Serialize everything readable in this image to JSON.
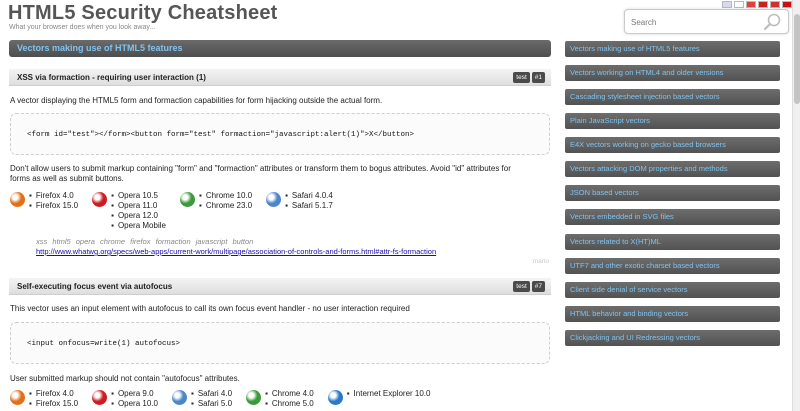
{
  "header": {
    "title": "HTML5 Security Cheatsheet",
    "tagline": "What your browser does when you look away...",
    "search_placeholder": "Search",
    "flags": [
      "#d8d8f0",
      "#ffffff",
      "#e04040",
      "#cc2020",
      "#d03030",
      "#cc1010"
    ]
  },
  "main": {
    "section_title": "Vectors making use of HTML5 features",
    "vectors": [
      {
        "title": "XSS via formaction - requiring user interaction (1)",
        "btn_test": "test",
        "btn_num": "#1",
        "description": "A vector displaying the HTML5 form and formaction capabilities for form hijacking outside the actual form.",
        "code": "<form id=\"test\"></form><button form=\"test\" formaction=\"javascript:alert(1)\">X</button>",
        "advice": "Don't allow users to submit markup containing \"form\" and \"formaction\" attributes or transform them to bogus attributes. Avoid \"id\" attributes for forms as well as submit buttons.",
        "browsers": [
          {
            "icon": "firefox-icon",
            "color": "#e0701c",
            "versions": [
              "Firefox 4.0",
              "Firefox 15.0"
            ]
          },
          {
            "icon": "opera-icon",
            "color": "#cc1b22",
            "versions": [
              "Opera 10.5",
              "Opera 11.0",
              "Opera 12.0",
              "Opera Mobile"
            ]
          },
          {
            "icon": "chrome-icon",
            "color": "#3c9a3c",
            "versions": [
              "Chrome 10.0",
              "Chrome 23.0"
            ]
          },
          {
            "icon": "safari-icon",
            "color": "#4a86c8",
            "versions": [
              "Safari 4.0.4",
              "Safari 5.1.7"
            ]
          }
        ],
        "tags": "xss html5 opera chrome firefox formaction javascript button",
        "link": "http://www.whatwg.org/specs/web-apps/current-work/multipage/association-of-controls-and-forms.html#attr-fs-formaction",
        "fade": "mario"
      },
      {
        "title": "Self-executing focus event via autofocus",
        "btn_test": "test",
        "btn_num": "#7",
        "description": "This vector uses an input element with autofocus to call its own focus event handler - no user interaction required",
        "code": "<input onfocus=write(1) autofocus>",
        "advice": "User submitted markup should not contain \"autofocus\" attributes.",
        "browsers": [
          {
            "icon": "firefox-icon",
            "color": "#e0701c",
            "versions": [
              "Firefox 4.0",
              "Firefox 15.0"
            ]
          },
          {
            "icon": "opera-icon",
            "color": "#cc1b22",
            "versions": [
              "Opera 9.0",
              "Opera 10.0"
            ]
          },
          {
            "icon": "safari-icon",
            "color": "#4a86c8",
            "versions": [
              "Safari 4.0",
              "Safari 5.0"
            ]
          },
          {
            "icon": "chrome-icon",
            "color": "#3c9a3c",
            "versions": [
              "Chrome 4.0",
              "Chrome 5.0"
            ]
          },
          {
            "icon": "ie-icon",
            "color": "#2a79c9",
            "versions": [
              "Internet Explorer 10.0"
            ]
          }
        ]
      }
    ]
  },
  "sidebar": {
    "items": [
      "Vectors making use of HTML5 features",
      "Vectors working on HTML4 and older versions",
      "Cascading stylesheet injection based vectors",
      "Plain JavaScript vectors",
      "E4X vectors working on gecko based browsers",
      "Vectors attacking DOM properties and methods",
      "JSON based vectors",
      "Vectors embedded in SVG files",
      "Vectors related to X(HT)ML",
      "UTF7 and other exotic charset based vectors",
      "Client side denial of service vectors",
      "HTML behavior and binding vectors",
      "Clickjacking and UI Redressing vectors"
    ]
  },
  "colors": {
    "accent": "#7fc3f0",
    "banner": "#555555",
    "link": "#1a0dab"
  }
}
